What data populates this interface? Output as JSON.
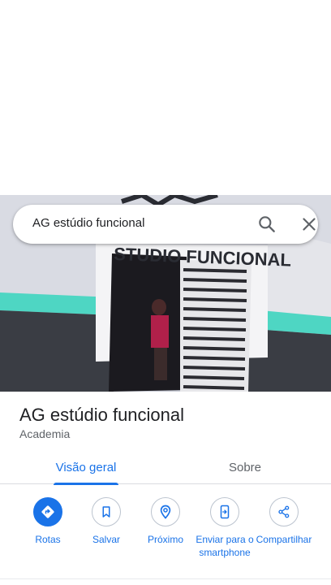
{
  "search": {
    "query": "AG estúdio funcional"
  },
  "photo": {
    "sign_text": "STUDIO FUNCIONAL"
  },
  "place": {
    "title": "AG estúdio funcional",
    "category": "Academia"
  },
  "tabs": [
    {
      "label": "Visão geral",
      "selected": true
    },
    {
      "label": "Sobre",
      "selected": false
    }
  ],
  "actions": [
    {
      "label": "Rotas",
      "icon": "directions-icon"
    },
    {
      "label": "Salvar",
      "icon": "bookmark-icon"
    },
    {
      "label": "Próximo",
      "icon": "nearby-icon"
    },
    {
      "label": "Enviar para o smartphone",
      "icon": "send-to-phone-icon"
    },
    {
      "label": "Compartilhar",
      "icon": "share-icon"
    }
  ],
  "colors": {
    "accent": "#1a73e8",
    "wall_stripe": "#4ed6c3",
    "wall_dark": "#3a3d44"
  }
}
